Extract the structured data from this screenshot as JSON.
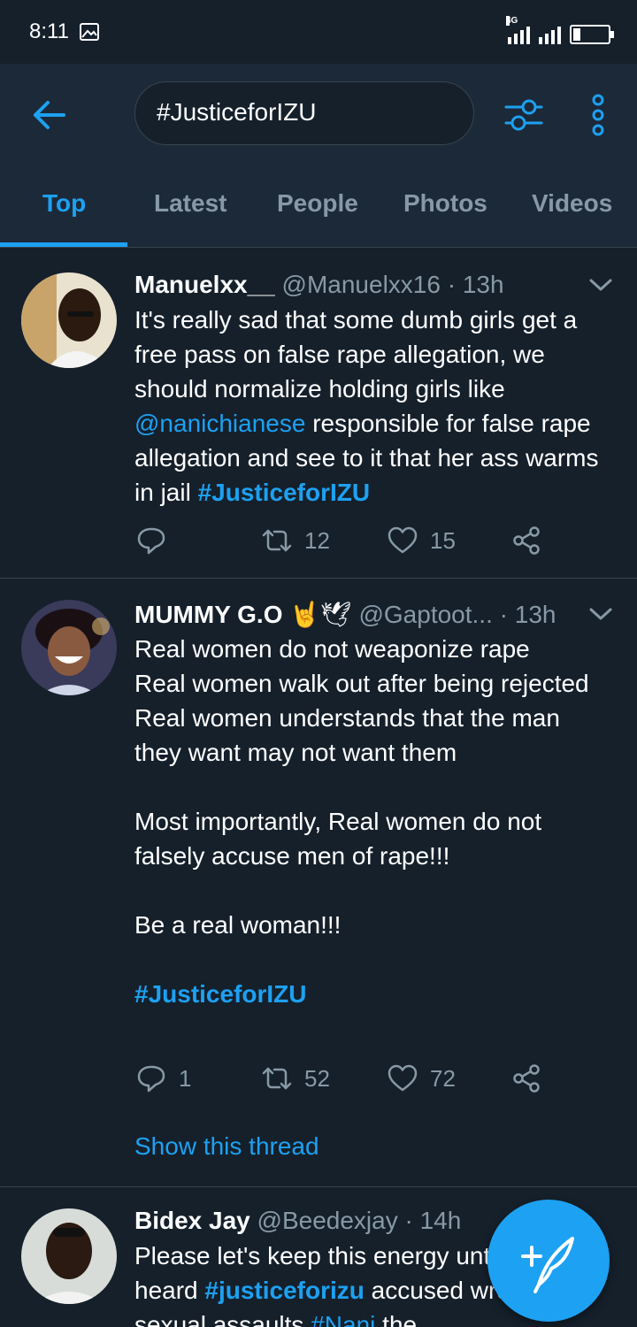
{
  "status_bar": {
    "time": "8:11",
    "network": "4G"
  },
  "search": {
    "value": "#JusticeforIZU"
  },
  "tabs": [
    "Top",
    "Latest",
    "People",
    "Photos",
    "Videos"
  ],
  "tweets": [
    {
      "name": "Manuelxx__",
      "handle": "@Manuelxx16",
      "time": "13h",
      "text_1": "It's really sad that some dumb girls get a free pass on false rape allegation, we should normalize holding girls like ",
      "mention": "@nanichianese",
      "text_2": " responsible for false rape allegation and see to it that her ass warms in jail ",
      "hashtag": "#JusticeforIZU",
      "replies": "",
      "retweets": "12",
      "likes": "15"
    },
    {
      "name": "MUMMY G.O",
      "emoji": "🤘🕊",
      "handle": "@Gaptoot...",
      "time": "13h",
      "lines": [
        "Real women do not weaponize rape",
        "Real women walk out after being rejected",
        "Real women understands that the man they want may not want them",
        "",
        "Most importantly, Real women do not falsely accuse men of rape!!!",
        "",
        "Be a real woman!!!",
        ""
      ],
      "hashtag": "#JusticeforIZU",
      "replies": "1",
      "retweets": "52",
      "likes": "72",
      "show_thread": "Show this thread"
    },
    {
      "name": "Bidex Jay",
      "handle": "@Beedexjay",
      "time": "14h",
      "text_1": "Please let's keep this energy until voice is heard ",
      "hashtag": "#justiceforizu",
      "text_2": " accused wrongly for sexual assaults ",
      "hashtag_2": "#Nani",
      "text_3": " the"
    }
  ],
  "colors": {
    "accent": "#1da1f2",
    "background": "#15202b",
    "header": "#1c2938",
    "muted": "#8899a6"
  }
}
